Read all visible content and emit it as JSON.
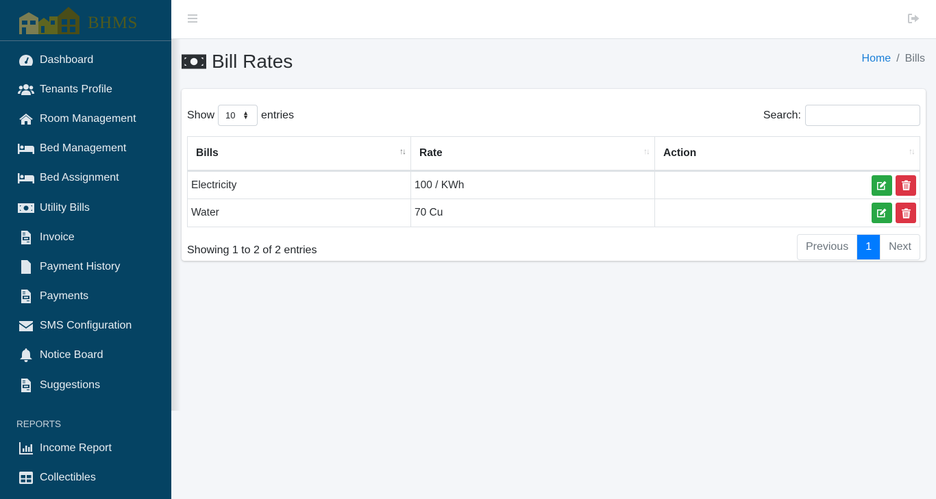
{
  "brand": {
    "name": "BHMS"
  },
  "sidebar": {
    "items": [
      {
        "label": "Dashboard",
        "icon": "tachometer-icon"
      },
      {
        "label": "Tenants Profile",
        "icon": "users-icon"
      },
      {
        "label": "Room Management",
        "icon": "home-icon"
      },
      {
        "label": "Bed Management",
        "icon": "bed-icon"
      },
      {
        "label": "Bed Assignment",
        "icon": "bed-icon"
      },
      {
        "label": "Utility Bills",
        "icon": "money-bill-icon"
      },
      {
        "label": "Invoice",
        "icon": "file-invoice-icon"
      },
      {
        "label": "Payment History",
        "icon": "file-icon"
      },
      {
        "label": "Payments",
        "icon": "file-invoice-icon"
      },
      {
        "label": "SMS Configuration",
        "icon": "envelope-icon"
      },
      {
        "label": "Notice Board",
        "icon": "bell-icon"
      },
      {
        "label": "Suggestions",
        "icon": "file-invoice-icon"
      }
    ],
    "reports_header": "REPORTS",
    "reports": [
      {
        "label": "Income Report",
        "icon": "chart-bar-icon"
      },
      {
        "label": "Collectibles",
        "icon": "table-icon"
      }
    ]
  },
  "topbar": {
    "menu_icon": "bars-icon",
    "logout_icon": "sign-out-icon"
  },
  "page": {
    "title": "Bill Rates",
    "title_icon": "money-bill-icon",
    "breadcrumb": {
      "home": "Home",
      "separator": "/",
      "current": "Bills"
    }
  },
  "table_controls": {
    "show_label": "Show",
    "entries_label": "entries",
    "page_length": "10",
    "search_label": "Search:",
    "search_value": "",
    "search_placeholder": ""
  },
  "table": {
    "columns": [
      "Bills",
      "Rate",
      "Action"
    ],
    "rows": [
      {
        "bill": "Electricity",
        "rate": "100 / KWh"
      },
      {
        "bill": "Water",
        "rate": "70 Cu"
      }
    ]
  },
  "footer": {
    "info": "Showing 1 to 2 of 2 entries",
    "previous": "Previous",
    "current_page": "1",
    "next": "Next"
  },
  "colors": {
    "sidebar_bg": "#054363",
    "edit_button": "#28a745",
    "delete_button": "#dc3545",
    "active_page": "#007bff",
    "link": "#1a7fd8"
  }
}
